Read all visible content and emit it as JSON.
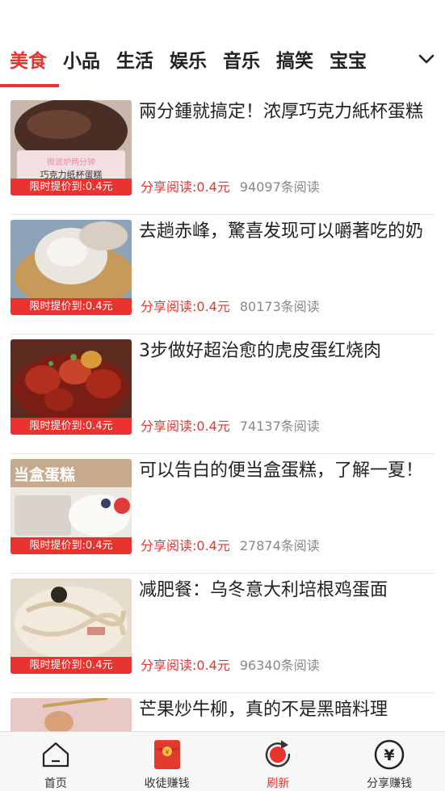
{
  "tabs": [
    {
      "label": "美食",
      "active": true
    },
    {
      "label": "小品"
    },
    {
      "label": "生活"
    },
    {
      "label": "娱乐"
    },
    {
      "label": "音乐"
    },
    {
      "label": "搞笑"
    },
    {
      "label": "宝宝"
    }
  ],
  "articles": [
    {
      "title": "兩分鍾就搞定！浓厚巧克力紙杯蛋糕",
      "badge": "限时提价到:0.4元",
      "share_earn": "分享阅读:0.4元",
      "reads": "94097条阅读",
      "thumb_caption": "微波炉两分钟\n巧克力纸杯蛋糕"
    },
    {
      "title": "去趟赤峰，驚喜发现可以嚼著吃的奶",
      "badge": "限时提价到:0.4元",
      "share_earn": "分享阅读:0.4元",
      "reads": "80173条阅读"
    },
    {
      "title": "3步做好超治愈的虎皮蛋红烧肉",
      "badge": "限时提价到:0.4元",
      "share_earn": "分享阅读:0.4元",
      "reads": "74137条阅读"
    },
    {
      "title": "可以告白的便当盒蛋糕，了解一夏！",
      "badge": "限时提价到:0.4元",
      "share_earn": "分享阅读:0.4元",
      "reads": "27874条阅读",
      "thumb_caption": "当盒蛋糕"
    },
    {
      "title": "减肥餐：乌冬意大利培根鸡蛋面",
      "badge": "限时提价到:0.4元",
      "share_earn": "分享阅读:0.4元",
      "reads": "96340条阅读"
    },
    {
      "title": "芒果炒牛柳，真的不是黑暗料理",
      "badge": "",
      "share_earn": "",
      "reads": ""
    }
  ],
  "bottom_nav": {
    "home": "首页",
    "recruit": "收徒赚钱",
    "refresh": "刷新",
    "share": "分享赚钱"
  },
  "colors": {
    "accent": "#e8332f"
  }
}
